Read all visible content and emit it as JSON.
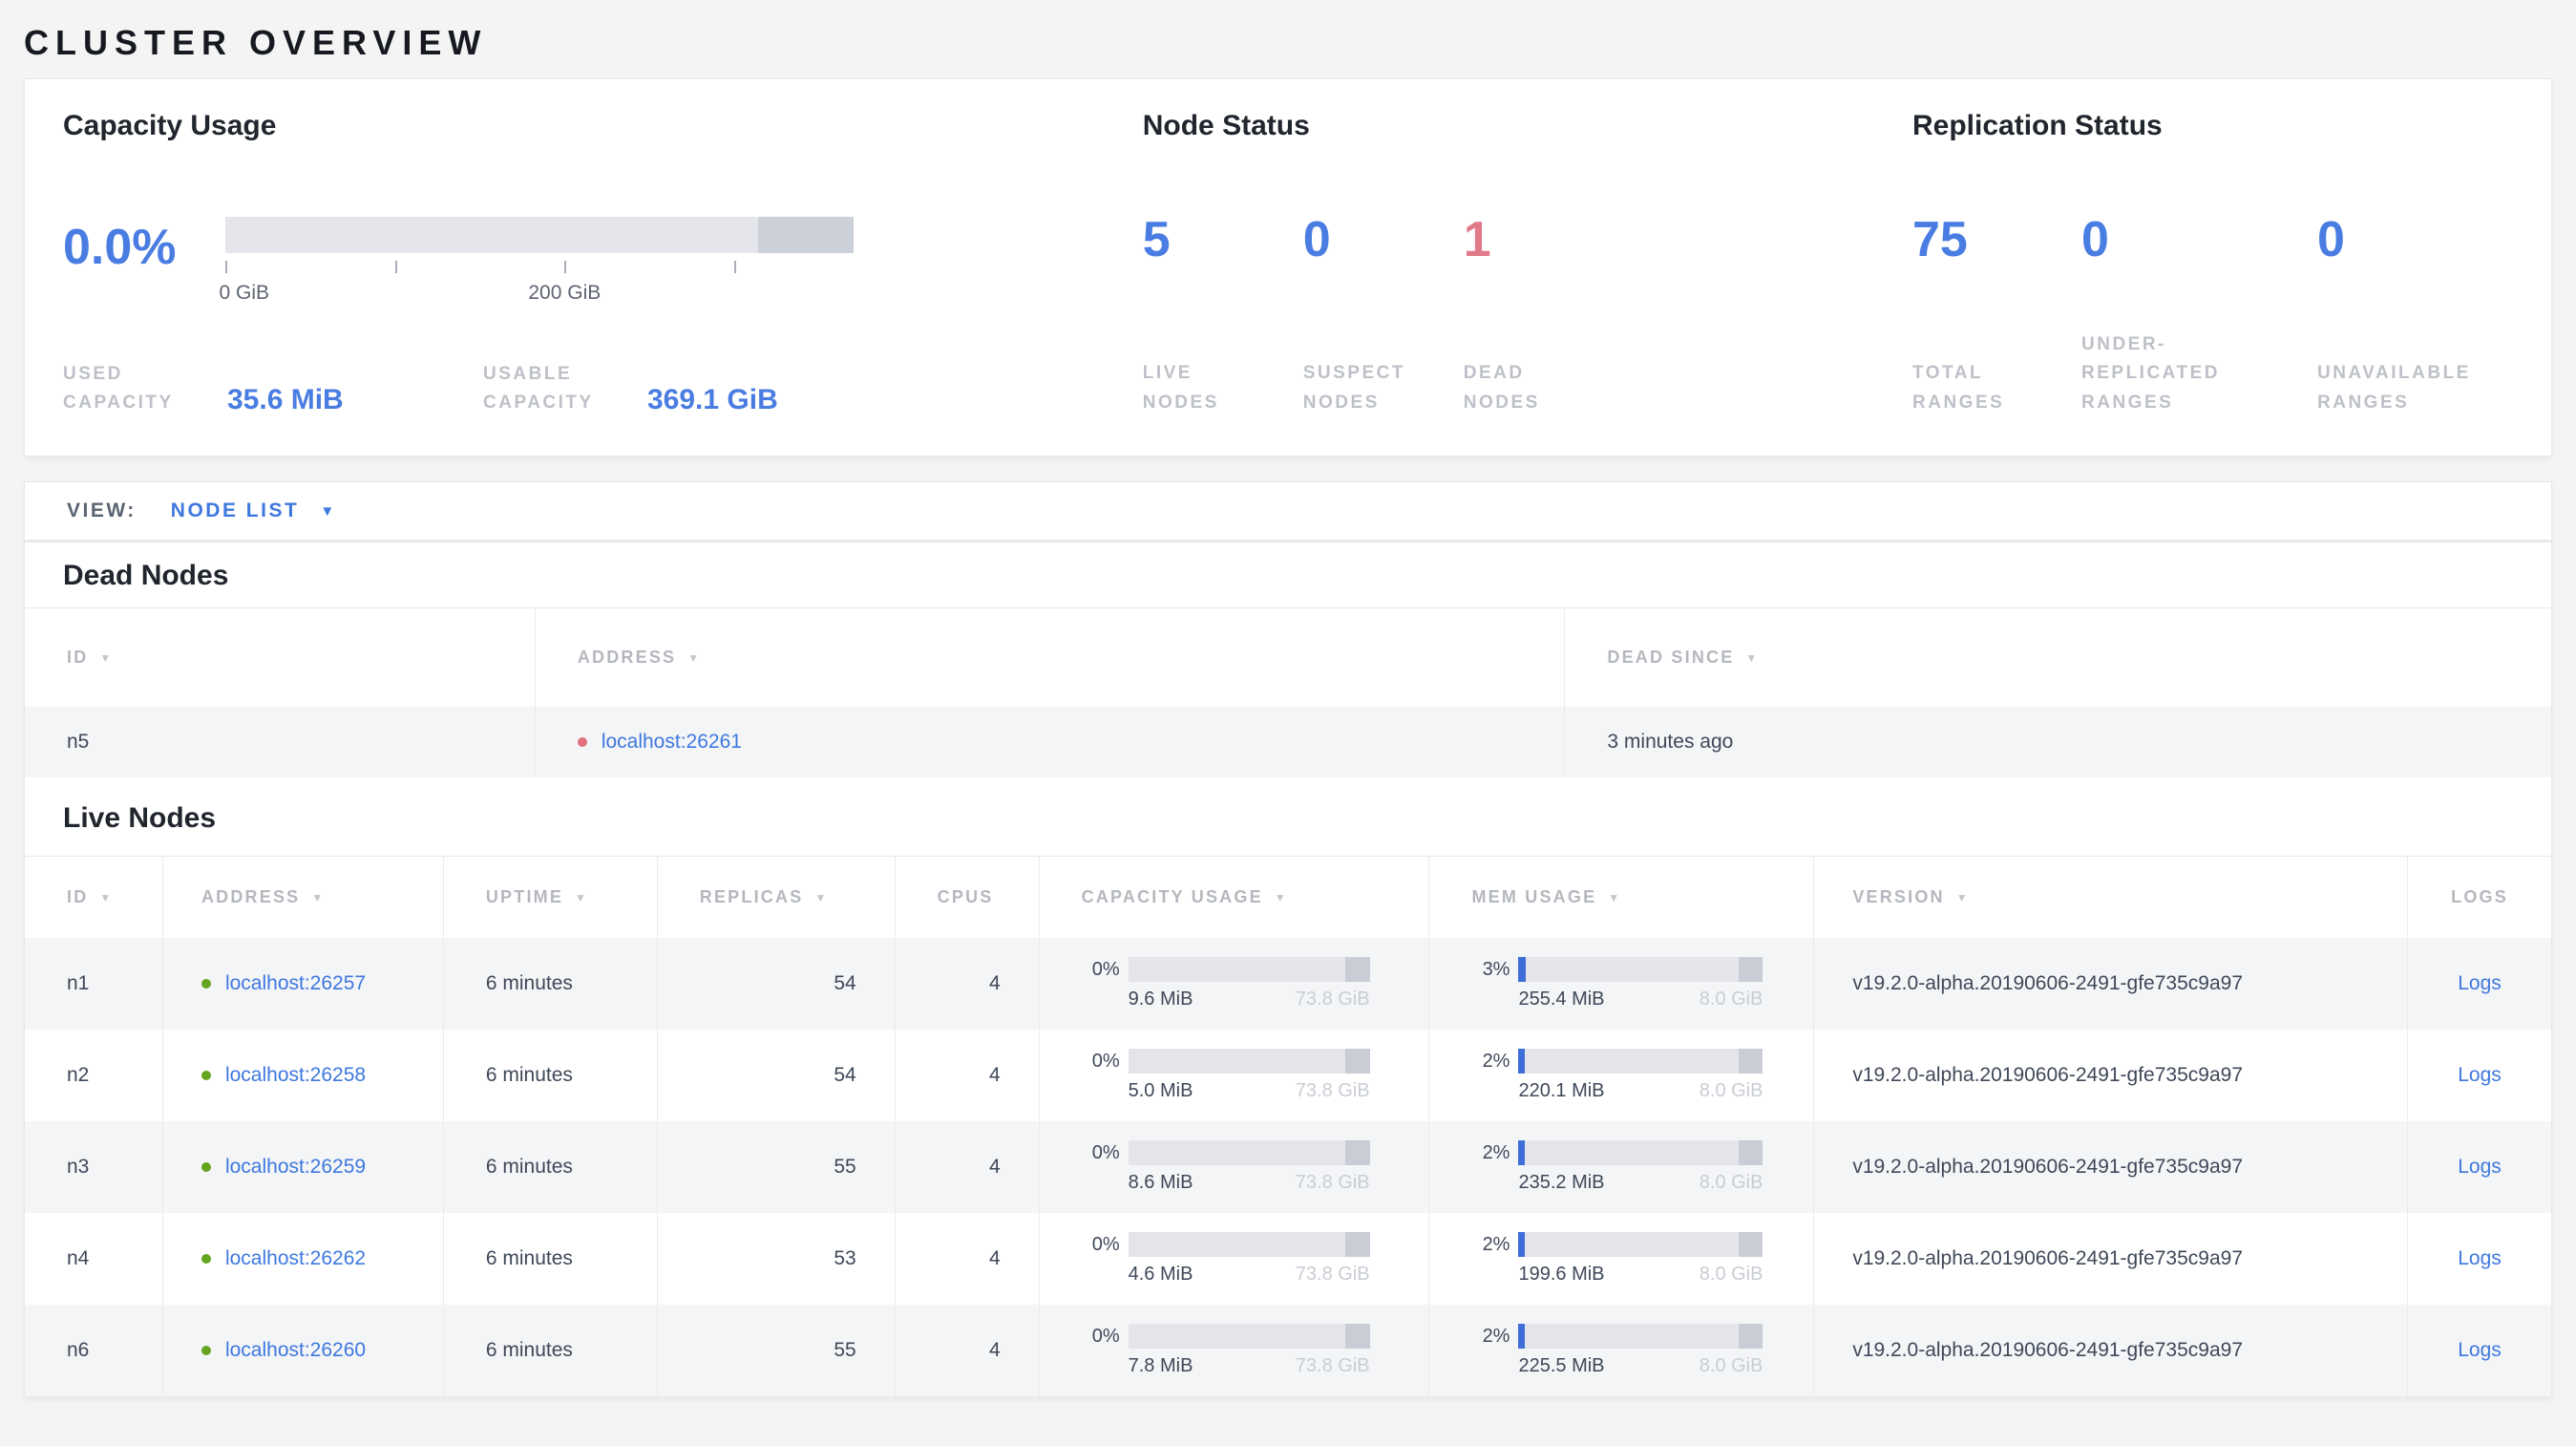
{
  "title": "CLUSTER OVERVIEW",
  "colors": {
    "accent_blue": "#4a7de2",
    "warn_red": "#e0798a",
    "link_blue": "#3e78de",
    "live_green": "#64a41e",
    "dead_red": "#e0707d"
  },
  "capacity_usage": {
    "heading": "Capacity Usage",
    "percent": "0.0%",
    "tick_label_0": "0 GiB",
    "tick_label_200": "200 GiB",
    "used_label": "USED CAPACITY",
    "used_value": "35.6 MiB",
    "usable_label": "USABLE CAPACITY",
    "usable_value": "369.1 GiB"
  },
  "node_status": {
    "heading": "Node Status",
    "live": {
      "value": "5",
      "label": "LIVE NODES"
    },
    "suspect": {
      "value": "0",
      "label": "SUSPECT NODES"
    },
    "dead": {
      "value": "1",
      "label": "DEAD NODES"
    }
  },
  "replication_status": {
    "heading": "Replication Status",
    "total": {
      "value": "75",
      "label": "TOTAL RANGES"
    },
    "under_replicated": {
      "value": "0",
      "label": "UNDER-REPLICATED RANGES"
    },
    "unavailable": {
      "value": "0",
      "label": "UNAVAILABLE RANGES"
    }
  },
  "view_bar": {
    "label": "VIEW:",
    "selected": "NODE LIST",
    "caret": "▼"
  },
  "sort_glyph": "▼",
  "dead_nodes": {
    "heading": "Dead Nodes",
    "columns": [
      {
        "label": "ID"
      },
      {
        "label": "ADDRESS"
      },
      {
        "label": "DEAD SINCE"
      }
    ],
    "rows": [
      {
        "id": "n5",
        "address": "localhost:26261",
        "dead_since": "3 minutes ago"
      }
    ]
  },
  "live_nodes": {
    "heading": "Live Nodes",
    "columns": [
      {
        "label": "ID"
      },
      {
        "label": "ADDRESS"
      },
      {
        "label": "UPTIME"
      },
      {
        "label": "REPLICAS"
      },
      {
        "label": "CPUS"
      },
      {
        "label": "CAPACITY USAGE"
      },
      {
        "label": "MEM USAGE"
      },
      {
        "label": "VERSION"
      },
      {
        "label": "LOGS"
      }
    ],
    "rows": [
      {
        "id": "n1",
        "address": "localhost:26257",
        "uptime": "6 minutes",
        "replicas": "54",
        "cpus": "4",
        "capacity": {
          "percent": "0%",
          "fill": "0%",
          "used": "9.6 MiB",
          "total": "73.8 GiB"
        },
        "mem": {
          "percent": "3%",
          "fill": "3%",
          "used": "255.4 MiB",
          "total": "8.0 GiB"
        },
        "version": "v19.2.0-alpha.20190606-2491-gfe735c9a97",
        "logs": "Logs"
      },
      {
        "id": "n2",
        "address": "localhost:26258",
        "uptime": "6 minutes",
        "replicas": "54",
        "cpus": "4",
        "capacity": {
          "percent": "0%",
          "fill": "0%",
          "used": "5.0 MiB",
          "total": "73.8 GiB"
        },
        "mem": {
          "percent": "2%",
          "fill": "2.5%",
          "used": "220.1 MiB",
          "total": "8.0 GiB"
        },
        "version": "v19.2.0-alpha.20190606-2491-gfe735c9a97",
        "logs": "Logs"
      },
      {
        "id": "n3",
        "address": "localhost:26259",
        "uptime": "6 minutes",
        "replicas": "55",
        "cpus": "4",
        "capacity": {
          "percent": "0%",
          "fill": "0%",
          "used": "8.6 MiB",
          "total": "73.8 GiB"
        },
        "mem": {
          "percent": "2%",
          "fill": "2.5%",
          "used": "235.2 MiB",
          "total": "8.0 GiB"
        },
        "version": "v19.2.0-alpha.20190606-2491-gfe735c9a97",
        "logs": "Logs"
      },
      {
        "id": "n4",
        "address": "localhost:26262",
        "uptime": "6 minutes",
        "replicas": "53",
        "cpus": "4",
        "capacity": {
          "percent": "0%",
          "fill": "0%",
          "used": "4.6 MiB",
          "total": "73.8 GiB"
        },
        "mem": {
          "percent": "2%",
          "fill": "2.5%",
          "used": "199.6 MiB",
          "total": "8.0 GiB"
        },
        "version": "v19.2.0-alpha.20190606-2491-gfe735c9a97",
        "logs": "Logs"
      },
      {
        "id": "n6",
        "address": "localhost:26260",
        "uptime": "6 minutes",
        "replicas": "55",
        "cpus": "4",
        "capacity": {
          "percent": "0%",
          "fill": "0%",
          "used": "7.8 MiB",
          "total": "73.8 GiB"
        },
        "mem": {
          "percent": "2%",
          "fill": "2.5%",
          "used": "225.5 MiB",
          "total": "8.0 GiB"
        },
        "version": "v19.2.0-alpha.20190606-2491-gfe735c9a97",
        "logs": "Logs"
      }
    ]
  }
}
